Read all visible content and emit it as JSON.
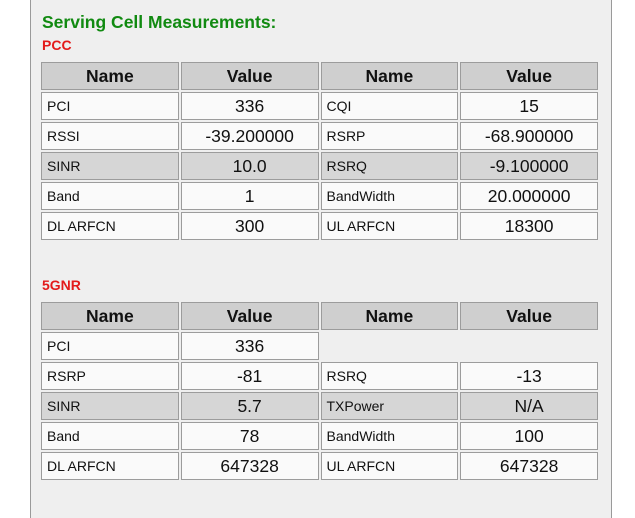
{
  "heading": "Serving Cell Measurements:",
  "pcc": {
    "label": "PCC",
    "headers": [
      "Name",
      "Value",
      "Name",
      "Value"
    ],
    "rows": [
      {
        "n1": "PCI",
        "v1": "336",
        "n2": "CQI",
        "v2": "15"
      },
      {
        "n1": "RSSI",
        "v1": "-39.200000",
        "n2": "RSRP",
        "v2": "-68.900000"
      },
      {
        "n1": "SINR",
        "v1": "10.0",
        "n2": "RSRQ",
        "v2": "-9.100000"
      },
      {
        "n1": "Band",
        "v1": "1",
        "n2": "BandWidth",
        "v2": "20.000000"
      },
      {
        "n1": "DL ARFCN",
        "v1": "300",
        "n2": "UL ARFCN",
        "v2": "18300"
      }
    ]
  },
  "nr": {
    "label": "5GNR",
    "headers": [
      "Name",
      "Value",
      "Name",
      "Value"
    ],
    "rows": [
      {
        "n1": "PCI",
        "v1": "336"
      },
      {
        "n1": "RSRP",
        "v1": "-81",
        "n2": "RSRQ",
        "v2": "-13"
      },
      {
        "n1": "SINR",
        "v1": "5.7",
        "n2": "TXPower",
        "v2": "N/A"
      },
      {
        "n1": "Band",
        "v1": "78",
        "n2": "BandWidth",
        "v2": "100"
      },
      {
        "n1": "DL ARFCN",
        "v1": "647328",
        "n2": "UL ARFCN",
        "v2": "647328"
      }
    ]
  }
}
